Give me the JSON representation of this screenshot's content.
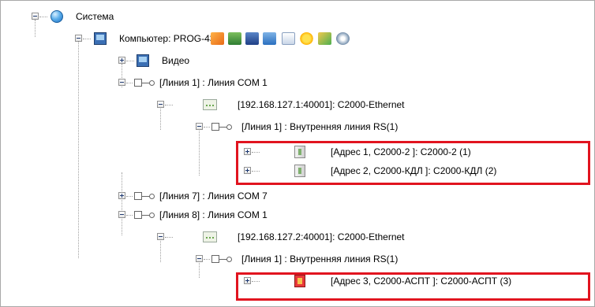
{
  "tree": {
    "system_label": "Система",
    "computer_label": "Компьютер: PROG-43",
    "video_label": "Видео",
    "line1_label": "[Линия 1] : Линия COM 1",
    "eth1_label": "[192.168.127.1:40001]: С2000-Ethernet",
    "rs1_label": "[Линия 1] : Внутренняя линия RS(1)",
    "dev1_label": "[Адрес 1, С2000-2 ]: С2000-2 (1)",
    "dev2_label": "[Адрес 2, С2000-КДЛ ]: С2000-КДЛ (2)",
    "line7_label": "[Линия 7] : Линия COM 7",
    "line8_label": "[Линия 8] : Линия COM 1",
    "eth2_label": "[192.168.127.2:40001]: С2000-Ethernet",
    "rs2_label": "[Линия 1] : Внутренняя линия RS(1)",
    "dev3_label": "[Адрес 3, С2000-АСПТ ]: С2000-АСПТ (3)"
  },
  "toolbar_icons": [
    "run-icon",
    "monitor-green-icon",
    "network-icon",
    "book-icon",
    "document-icon",
    "sun-icon",
    "key-icon",
    "disk-icon"
  ],
  "colors": {
    "highlight": "#e1141f"
  }
}
